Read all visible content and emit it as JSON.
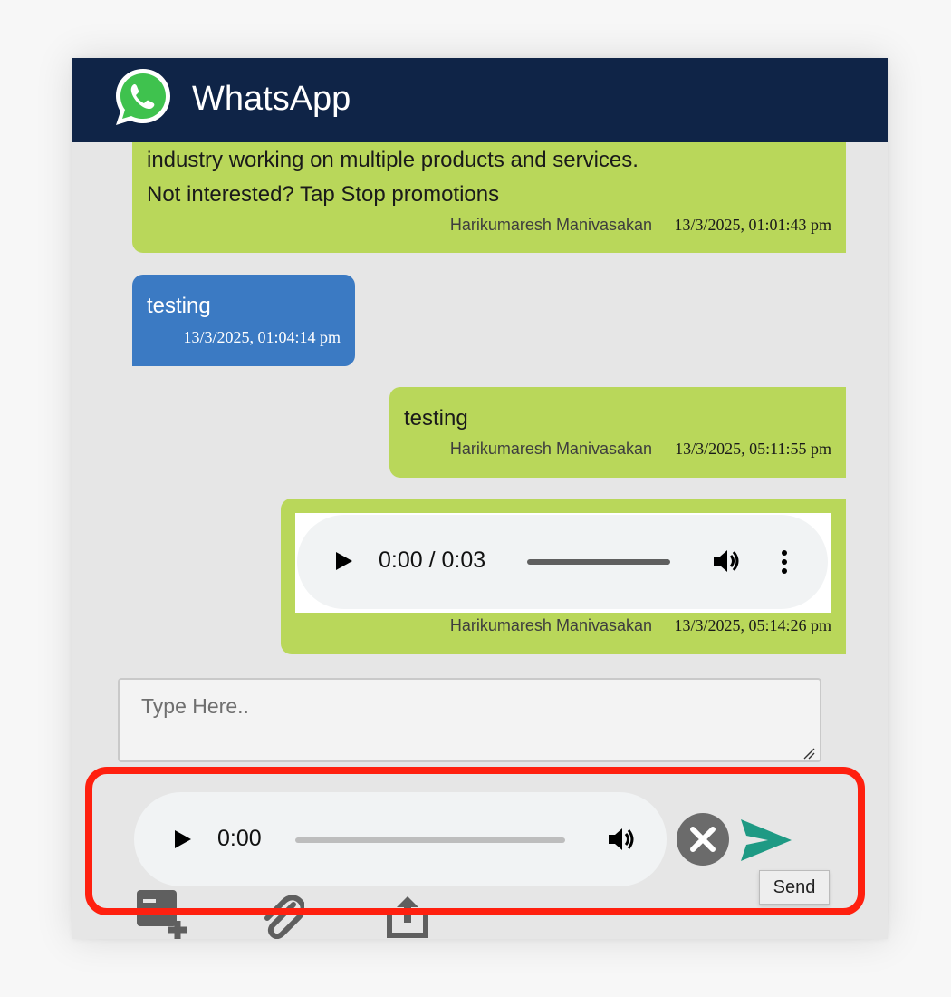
{
  "app": {
    "title": "WhatsApp"
  },
  "messages": [
    {
      "type": "outgoing",
      "lines": [
        "industry working on multiple products and services.",
        "Not interested? Tap Stop promotions"
      ],
      "sender": "Harikumaresh Manivasakan",
      "time": "13/3/2025, 01:01:43 pm"
    },
    {
      "type": "incoming",
      "text": "testing",
      "time": "13/3/2025, 01:04:14 pm"
    },
    {
      "type": "outgoing",
      "text": "testing",
      "sender": "Harikumaresh Manivasakan",
      "time": "13/3/2025, 05:11:55 pm"
    },
    {
      "type": "outgoing-audio",
      "audio": {
        "time_display": "0:00 / 0:03",
        "progress": 0
      },
      "sender": "Harikumaresh Manivasakan",
      "time": "13/3/2025, 05:14:26 pm"
    }
  ],
  "composer": {
    "placeholder": "Type Here..",
    "value": ""
  },
  "recording": {
    "time_display": "0:00",
    "progress": 0
  },
  "send": {
    "tooltip": "Send"
  },
  "icons": {
    "logo": "whatsapp-logo",
    "play": "play-icon",
    "volume": "volume-icon",
    "more": "more-options-icon",
    "cancel": "cancel-recording-icon",
    "send": "send-icon",
    "template": "add-template-icon",
    "attach": "attachment-icon",
    "share": "share-upload-icon"
  },
  "colors": {
    "header": "#0f2447",
    "outgoing_bubble": "#b9d75a",
    "incoming_bubble": "#3b7ac3",
    "send": "#1e9a84",
    "highlight": "#ff200f"
  }
}
